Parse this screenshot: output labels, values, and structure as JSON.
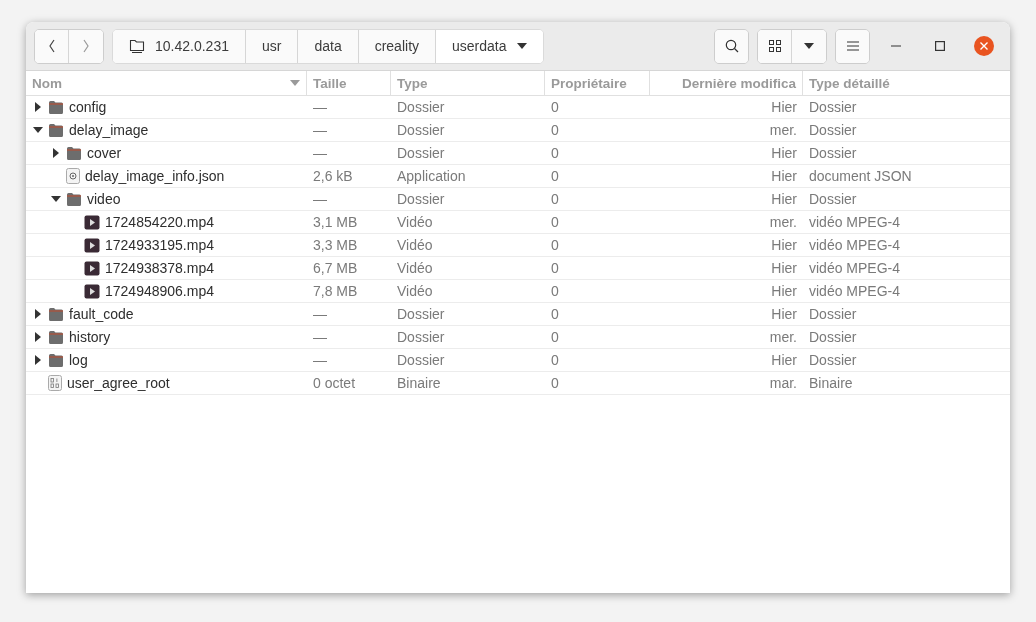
{
  "path": {
    "segments": [
      {
        "label": "10.42.0.231",
        "kind": "root",
        "selected": false
      },
      {
        "label": "usr",
        "kind": "dir",
        "selected": false
      },
      {
        "label": "data",
        "kind": "dir",
        "selected": false
      },
      {
        "label": "creality",
        "kind": "dir",
        "selected": false
      },
      {
        "label": "userdata",
        "kind": "dir",
        "selected": true
      }
    ]
  },
  "table": {
    "columns": [
      {
        "label": "Nom",
        "sorted": true
      },
      {
        "label": "Taille",
        "sorted": false
      },
      {
        "label": "Type",
        "sorted": false
      },
      {
        "label": "Propriétaire",
        "sorted": false
      },
      {
        "label": "Dernière modifica",
        "sorted": false
      },
      {
        "label": "Type détaillé",
        "sorted": false
      }
    ],
    "rows": [
      {
        "name": "config",
        "kind": "folder",
        "expanded": false,
        "size": "—",
        "type": "Dossier",
        "owner": "0",
        "modified": "Hier",
        "detail": "Dossier"
      },
      {
        "name": "delay_image",
        "kind": "folder",
        "expanded": true,
        "size": "—",
        "type": "Dossier",
        "owner": "0",
        "modified": "mer.",
        "detail": "Dossier",
        "children": [
          {
            "name": "cover",
            "kind": "folder",
            "expanded": false,
            "size": "—",
            "type": "Dossier",
            "owner": "0",
            "modified": "Hier",
            "detail": "Dossier"
          },
          {
            "name": "delay_image_info.json",
            "kind": "json",
            "size": "2,6 kB",
            "type": "Application",
            "owner": "0",
            "modified": "Hier",
            "detail": "document JSON"
          },
          {
            "name": "video",
            "kind": "folder",
            "expanded": true,
            "size": "—",
            "type": "Dossier",
            "owner": "0",
            "modified": "Hier",
            "detail": "Dossier",
            "children": [
              {
                "name": "1724854220.mp4",
                "kind": "video",
                "size": "3,1 MB",
                "type": "Vidéo",
                "owner": "0",
                "modified": "mer.",
                "detail": "vidéo MPEG-4"
              },
              {
                "name": "1724933195.mp4",
                "kind": "video",
                "size": "3,3 MB",
                "type": "Vidéo",
                "owner": "0",
                "modified": "Hier",
                "detail": "vidéo MPEG-4"
              },
              {
                "name": "1724938378.mp4",
                "kind": "video",
                "size": "6,7 MB",
                "type": "Vidéo",
                "owner": "0",
                "modified": "Hier",
                "detail": "vidéo MPEG-4"
              },
              {
                "name": "1724948906.mp4",
                "kind": "video",
                "size": "7,8 MB",
                "type": "Vidéo",
                "owner": "0",
                "modified": "Hier",
                "detail": "vidéo MPEG-4"
              }
            ]
          }
        ]
      },
      {
        "name": "fault_code",
        "kind": "folder",
        "expanded": false,
        "size": "—",
        "type": "Dossier",
        "owner": "0",
        "modified": "Hier",
        "detail": "Dossier"
      },
      {
        "name": "history",
        "kind": "folder",
        "expanded": false,
        "size": "—",
        "type": "Dossier",
        "owner": "0",
        "modified": "mer.",
        "detail": "Dossier"
      },
      {
        "name": "log",
        "kind": "folder",
        "expanded": false,
        "size": "—",
        "type": "Dossier",
        "owner": "0",
        "modified": "Hier",
        "detail": "Dossier"
      },
      {
        "name": "user_agree_root",
        "kind": "binary",
        "size": "0 octet",
        "type": "Binaire",
        "owner": "0",
        "modified": "mar.",
        "detail": "Binaire"
      }
    ]
  }
}
